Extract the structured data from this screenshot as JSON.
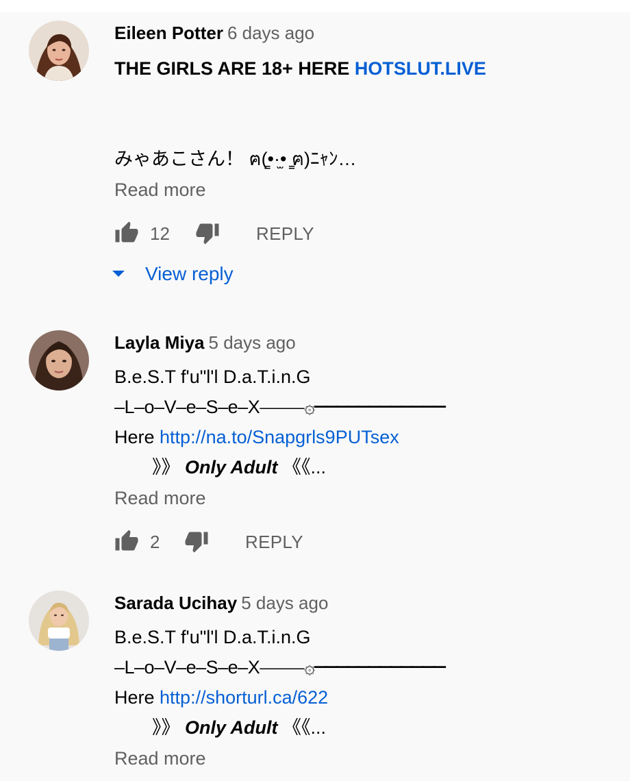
{
  "comments": [
    {
      "author": "Eileen Potter",
      "time": "6 days ago",
      "line1_text": "THE GIRLS ARE 18+ HERE ",
      "line1_link": "HOTSLUT.LIVE",
      "line2": "みゃあこさん！ ฅ(̳•·̫• ̳ฅ)ﾆｬﾝ…",
      "read_more": "Read more",
      "likes": "12",
      "reply_label": "REPLY",
      "view_reply": "View reply"
    },
    {
      "author": "Layla Miya",
      "time": "5 days ago",
      "line1": "B.e.S.T f'u\"l'l D.a.T.i.n.G",
      "line2": "–L–o–V–e–S–e–X⎯⎯⎯⎯⎯۞⎯⎯⎯⎯⎯⎯⎯⎯⎯⎯⎯⎯",
      "here": " Here  ",
      "link": "http://na.to/Snapgrls9PUTsex",
      "line4_prefix": "》》 ",
      "line4_bold": "Only Adult",
      "line4_suffix": " 《《...",
      "read_more": "Read more",
      "likes": "2",
      "reply_label": "REPLY"
    },
    {
      "author": "Sarada Ucihay",
      "time": "5 days ago",
      "line1": "B.e.S.T f'u\"l'l D.a.T.i.n.G",
      "line2": "–L–o–V–e–S–e–X⎯⎯⎯⎯⎯۞⎯⎯⎯⎯⎯⎯⎯⎯⎯⎯⎯⎯",
      "here": " Here  ",
      "link": "http://shorturl.ca/622",
      "line4_prefix": "》》 ",
      "line4_bold": "Only Adult",
      "line4_suffix": " 《《...",
      "read_more": "Read more"
    }
  ],
  "icons": {
    "like": "thumb-up-icon",
    "dislike": "thumb-down-icon",
    "caret": "caret-down-icon"
  },
  "colors": {
    "link": "#065fd4",
    "secondary_text": "#606060",
    "background": "#f9f9f9"
  }
}
